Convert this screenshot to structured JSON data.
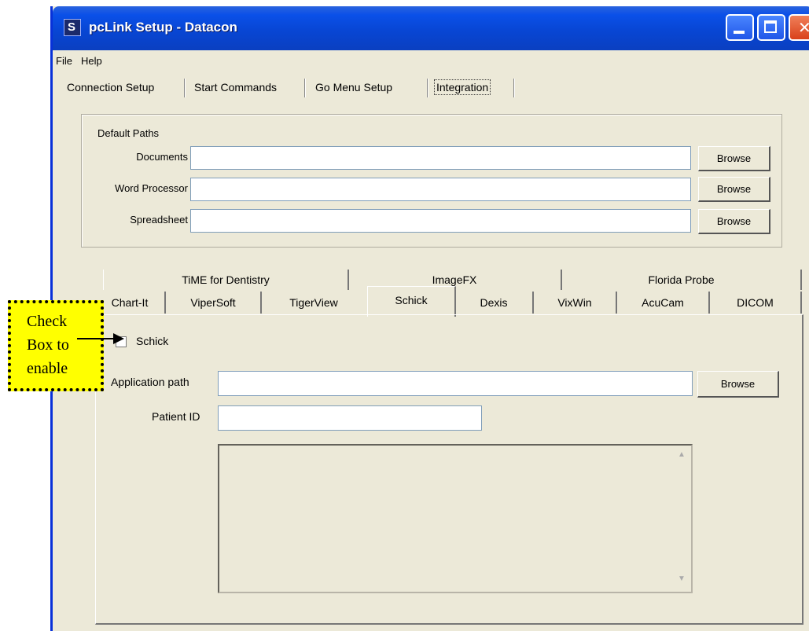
{
  "window": {
    "title": "pcLink Setup - Datacon"
  },
  "menu": [
    "File",
    "Help"
  ],
  "main_tabs": [
    "Connection Setup",
    "Start Commands",
    "Go Menu Setup",
    "Integration"
  ],
  "active_main_tab": "Integration",
  "default_paths": {
    "title": "Default Paths",
    "rows": [
      {
        "label": "Documents",
        "value": "",
        "button": "Browse"
      },
      {
        "label": "Word Processor",
        "value": "",
        "button": "Browse"
      },
      {
        "label": "Spreadsheet",
        "value": "",
        "button": "Browse"
      }
    ]
  },
  "sub_tabs_row1": [
    "TiME for Dentistry",
    "ImageFX",
    "Florida Probe"
  ],
  "sub_tabs_row2": [
    "Chart-It",
    "ViperSoft",
    "TigerView",
    "Schick",
    "Dexis",
    "VixWin",
    "AcuCam",
    "DICOM"
  ],
  "active_sub_tab": "Schick",
  "schick": {
    "checkbox_label": "Schick",
    "checked": false,
    "app_path_label": "Application path",
    "app_path_value": "",
    "browse_label": "Browse",
    "patient_id_label": "Patient ID",
    "patient_id_value": ""
  },
  "callout": {
    "lines": [
      "Check",
      "Box to",
      "enable"
    ]
  },
  "colors": {
    "window_bg": "#ece9d8",
    "titlebar": "#0846d4",
    "callout_bg": "#ffff00"
  }
}
